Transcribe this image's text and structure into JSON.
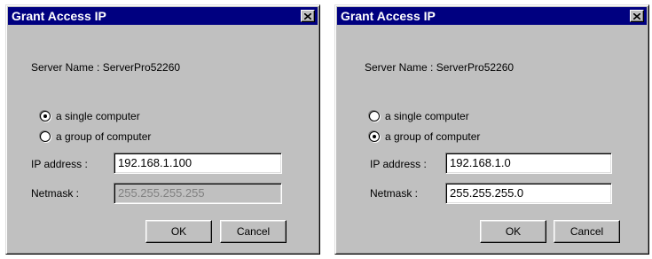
{
  "dialogs": [
    {
      "title": "Grant Access IP",
      "server_name": "Server Name : ServerPro52260",
      "radio_single": {
        "label": "a single computer",
        "checked": true
      },
      "radio_group": {
        "label": "a group of computer",
        "checked": false
      },
      "ip_label": "IP address :",
      "ip_value": "192.168.1.100",
      "netmask_label": "Netmask :",
      "netmask_value": "255.255.255.255",
      "netmask_enabled": false,
      "ok_label": "OK",
      "cancel_label": "Cancel"
    },
    {
      "title": "Grant Access IP",
      "server_name": "Server Name : ServerPro52260",
      "radio_single": {
        "label": "a single computer",
        "checked": false
      },
      "radio_group": {
        "label": "a group of computer",
        "checked": true
      },
      "ip_label": "IP address :",
      "ip_value": "192.168.1.0",
      "netmask_label": "Netmask :",
      "netmask_value": "255.255.255.0",
      "netmask_enabled": true,
      "ok_label": "OK",
      "cancel_label": "Cancel"
    }
  ],
  "icons": {
    "close": "close-icon",
    "radio": "radio-button"
  },
  "colors": {
    "titlebar": "#000080",
    "dialog_bg": "#c0c0c0",
    "disabled_text": "#808080"
  }
}
